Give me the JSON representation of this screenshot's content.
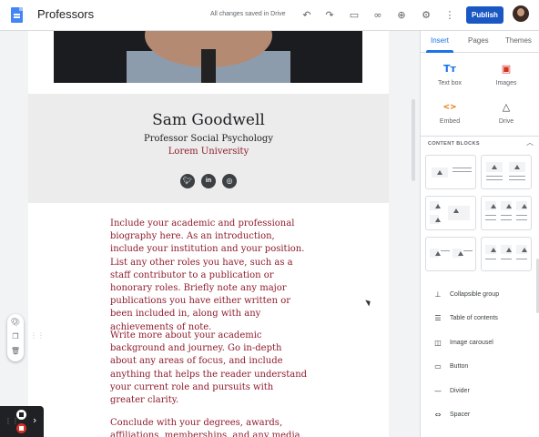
{
  "topbar": {
    "title": "Professors",
    "saved_status": "All changes saved in Drive",
    "publish_label": "Publish",
    "icons": [
      "undo-icon",
      "redo-icon",
      "preview-icon",
      "link-icon",
      "share-icon",
      "settings-icon",
      "more-icon"
    ]
  },
  "page": {
    "name": "Sam Goodwell",
    "role": "Professor Social Psychology",
    "university": "Lorem University",
    "social_icons": [
      "twitter-icon",
      "linkedin-icon",
      "instagram-icon"
    ],
    "paragraphs": [
      "Include your academic and professional biography here. As an introduction, include your institution and your position. List any other roles you have, such as a staff contributor to a publication or honorary roles. Briefly note any major publications you have either written or been included in, along with any achievements of note.",
      "Write more about your academic background and journey. Go in-depth about any areas of focus, and include anything that helps the reader understand your current role and pursuits with greater clarity.",
      "Conclude with your degrees, awards, affiliations, memberships, and any media"
    ],
    "accent_color": "#8f1b2c"
  },
  "panel": {
    "tabs": [
      "Insert",
      "Pages",
      "Themes"
    ],
    "active_tab": "Insert",
    "insert_items": [
      {
        "icon": "Tт",
        "label": "Text box",
        "color": "#1a73e8"
      },
      {
        "icon": "▣",
        "label": "Images",
        "color": "#d93025"
      },
      {
        "icon": "<>",
        "label": "Embed",
        "color": "#e37400"
      },
      {
        "icon": "△",
        "label": "Drive",
        "color": "#3c4043"
      }
    ],
    "content_blocks_header": "CONTENT BLOCKS",
    "list_items": [
      {
        "icon": "⊥",
        "label": "Collapsible group"
      },
      {
        "icon": "☰",
        "label": "Table of contents"
      },
      {
        "icon": "◫",
        "label": "Image carousel"
      },
      {
        "icon": "▭",
        "label": "Button"
      },
      {
        "icon": "—",
        "label": "Divider"
      },
      {
        "icon": "⇔",
        "label": "Spacer"
      }
    ]
  }
}
